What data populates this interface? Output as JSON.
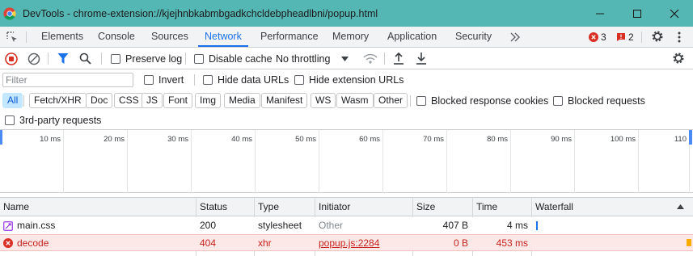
{
  "window": {
    "title": "DevTools - chrome-extension://kjejhnbkabmbgadkchcldebpheadlbni/popup.html",
    "controls": [
      "minimize-icon",
      "maximize-icon",
      "close-icon"
    ]
  },
  "tabs": {
    "items": [
      "Elements",
      "Console",
      "Sources",
      "Network",
      "Performance",
      "Memory",
      "Application",
      "Security"
    ],
    "active": "Network",
    "more": "more-tabs-icon",
    "errors_count": "3",
    "issues_count": "2"
  },
  "toolbar": {
    "preserve_log": "Preserve log",
    "disable_cache": "Disable cache",
    "throttling": "No throttling"
  },
  "filter": {
    "placeholder": "Filter",
    "invert": "Invert",
    "hide_data_urls": "Hide data URLs",
    "hide_extension_urls": "Hide extension URLs"
  },
  "types": {
    "chips": [
      "All",
      "Fetch/XHR",
      "Doc",
      "CSS",
      "JS",
      "Font",
      "Img",
      "Media",
      "Manifest",
      "WS",
      "Wasm",
      "Other"
    ],
    "active": "All",
    "blocked_response_cookies": "Blocked response cookies",
    "blocked_requests": "Blocked requests",
    "third_party": "3rd-party requests"
  },
  "overview": {
    "ticks": [
      "10 ms",
      "20 ms",
      "30 ms",
      "40 ms",
      "50 ms",
      "60 ms",
      "70 ms",
      "80 ms",
      "90 ms",
      "100 ms",
      "110"
    ]
  },
  "table": {
    "columns": [
      "Name",
      "Status",
      "Type",
      "Initiator",
      "Size",
      "Time",
      "Waterfall"
    ],
    "rows": [
      {
        "name": "main.css",
        "status": "200",
        "type": "stylesheet",
        "initiator": "Other",
        "size": "407 B",
        "time": "4 ms",
        "error": false
      },
      {
        "name": "decode",
        "status": "404",
        "type": "xhr",
        "initiator": "popup.js:2284",
        "size": "0 B",
        "time": "453 ms",
        "error": true
      }
    ]
  },
  "colors": {
    "titlebar": "#54b7b4",
    "accent": "#1a73e8",
    "error": "#c5221f",
    "error_row_bg": "#fce8e6"
  }
}
